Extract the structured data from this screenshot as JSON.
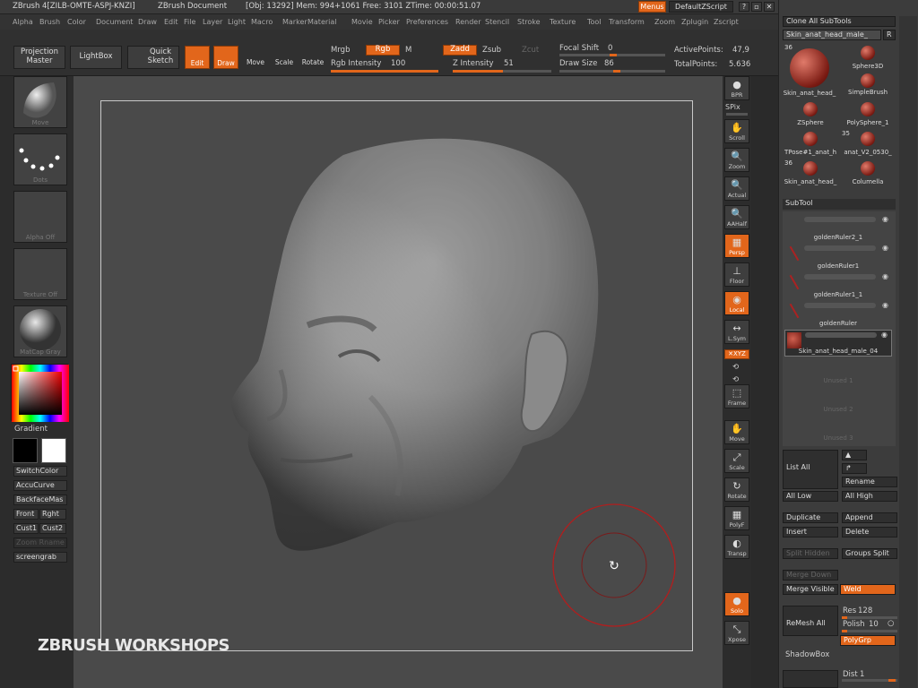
{
  "titlebar": {
    "app": "ZBrush 4[ZILB-OMTE-ASPJ-KNZI]",
    "doc": "ZBrush Document",
    "stats": "[Obj: 13292] Mem: 994+1061 Free: 3101 ZTime: 00:00:51.07",
    "menus_btn": "Menus",
    "zscript": "DefaultZScript"
  },
  "menubar": [
    "Alpha",
    "Brush",
    "Color",
    "Document",
    "Draw",
    "Edit",
    "File",
    "Layer",
    "Light",
    "Macro",
    "Marker",
    "Material",
    "Movie",
    "Picker",
    "Preferences",
    "Render",
    "Stencil",
    "Stroke",
    "Texture",
    "Tool",
    "Transform",
    "Zoom",
    "Zplugin",
    "Zscript"
  ],
  "topshelf": {
    "projection_master": "Projection\nMaster",
    "lightbox": "LightBox",
    "quick_sketch": "Quick\nSketch",
    "edit": "Edit",
    "draw": "Draw",
    "move": "Move",
    "scale": "Scale",
    "rotate": "Rotate",
    "mrgb": "Mrgb",
    "rgb": "Rgb",
    "m": "M",
    "rgb_intensity_label": "Rgb Intensity",
    "rgb_intensity": "100",
    "rgb_intensity_fill": 1.0,
    "zadd": "Zadd",
    "zsub": "Zsub",
    "zcut": "Zcut",
    "z_intensity_label": "Z Intensity",
    "z_intensity": "51",
    "z_intensity_fill": 0.51,
    "focal_shift_label": "Focal Shift",
    "focal_shift": "0",
    "draw_size_label": "Draw Size",
    "draw_size": "86",
    "active_points_label": "ActivePoints:",
    "active_points": "47,9",
    "total_points_label": "TotalPoints:",
    "total_points": "5.636"
  },
  "leftshelf": {
    "brush_caption": "Move",
    "stroke_caption": "Dots",
    "alpha_caption": "Alpha Off",
    "texture_caption": "Texture Off",
    "material_caption": "MatCap Gray",
    "gradient": "Gradient",
    "switchcolor": "SwitchColor",
    "accucurve": "AccuCurve",
    "backfacemask": "BackfaceMas",
    "front": "Front",
    "right": "Rght",
    "cust1": "Cust1",
    "cust2": "Cust2",
    "zoom_rename": "Zoom Rname",
    "screengrab": "screengrab"
  },
  "canvas": {
    "watermark": "ZBRUSH WORKSHOPS"
  },
  "rightshelf": [
    {
      "label": "BPR",
      "glyph": "●"
    },
    {
      "label": "Scroll",
      "glyph": "✋"
    },
    {
      "label": "Zoom",
      "glyph": "🔍"
    },
    {
      "label": "Actual",
      "glyph": "🔍"
    },
    {
      "label": "AAHalf",
      "glyph": "🔍"
    },
    {
      "label": "Persp",
      "glyph": "▦"
    },
    {
      "label": "Floor",
      "glyph": "⊥"
    },
    {
      "label": "Local",
      "glyph": "◉"
    },
    {
      "label": "L.Sym",
      "glyph": "↔"
    },
    {
      "label": "Frame",
      "glyph": "⬚"
    },
    {
      "label": "Move",
      "glyph": "✋"
    },
    {
      "label": "Scale",
      "glyph": "⤢"
    },
    {
      "label": "Rotate",
      "glyph": "↻"
    },
    {
      "label": "PolyF",
      "glyph": "▦"
    },
    {
      "label": "Transp",
      "glyph": "◐"
    },
    {
      "label": "Solo",
      "glyph": "●"
    },
    {
      "label": "Xpose",
      "glyph": "⤡"
    }
  ],
  "spix": "SPix",
  "xyz": "✕XYZ",
  "panel": {
    "clone_all": "Clone  All SubTools",
    "tool_name": "Skin_anat_head_male_",
    "r_btn": "R",
    "tools": [
      {
        "count": "36",
        "name": "Skin_anat_head_",
        "big": true
      },
      {
        "count": "",
        "name": "Sphere3D"
      },
      {
        "count": "",
        "name": "SimpleBrush"
      },
      {
        "count": "",
        "name": "ZSphere"
      },
      {
        "count": "",
        "name": "PolySphere_1"
      },
      {
        "count": "",
        "name": "TPose#1_anat_h"
      },
      {
        "count": "35",
        "name": "anat_V2_0530_"
      },
      {
        "count": "36",
        "name": "Skin_anat_head_"
      },
      {
        "count": "",
        "name": "Columella"
      }
    ],
    "subtool_header": "SubTool",
    "subtools": [
      {
        "name": "goldenRuler2_1"
      },
      {
        "name": "goldenRuler1"
      },
      {
        "name": "goldenRuler1_1"
      },
      {
        "name": "goldenRuler"
      },
      {
        "name": "Skin_anat_head_male_04"
      },
      {
        "name": "Unused 1"
      },
      {
        "name": "Unused 2"
      },
      {
        "name": "Unused 3"
      }
    ],
    "list_all": "List  All",
    "rename": "Rename",
    "all_low": "All Low",
    "all_high": "All High",
    "duplicate": "Duplicate",
    "append": "Append",
    "insert": "Insert",
    "delete": "Delete",
    "split_hidden": "Split Hidden",
    "groups_split": "Groups Split",
    "merge_down": "Merge Down",
    "merge_visible": "Merge Visible",
    "weld": "Weld",
    "remesh_all": "ReMesh All",
    "res_label": "Res",
    "res": "128",
    "polish_label": "Polish",
    "polish": "10",
    "polygrp": "PolyGrp",
    "shadowbox": "ShadowBox",
    "dist_label": "Dist",
    "dist": "1"
  }
}
